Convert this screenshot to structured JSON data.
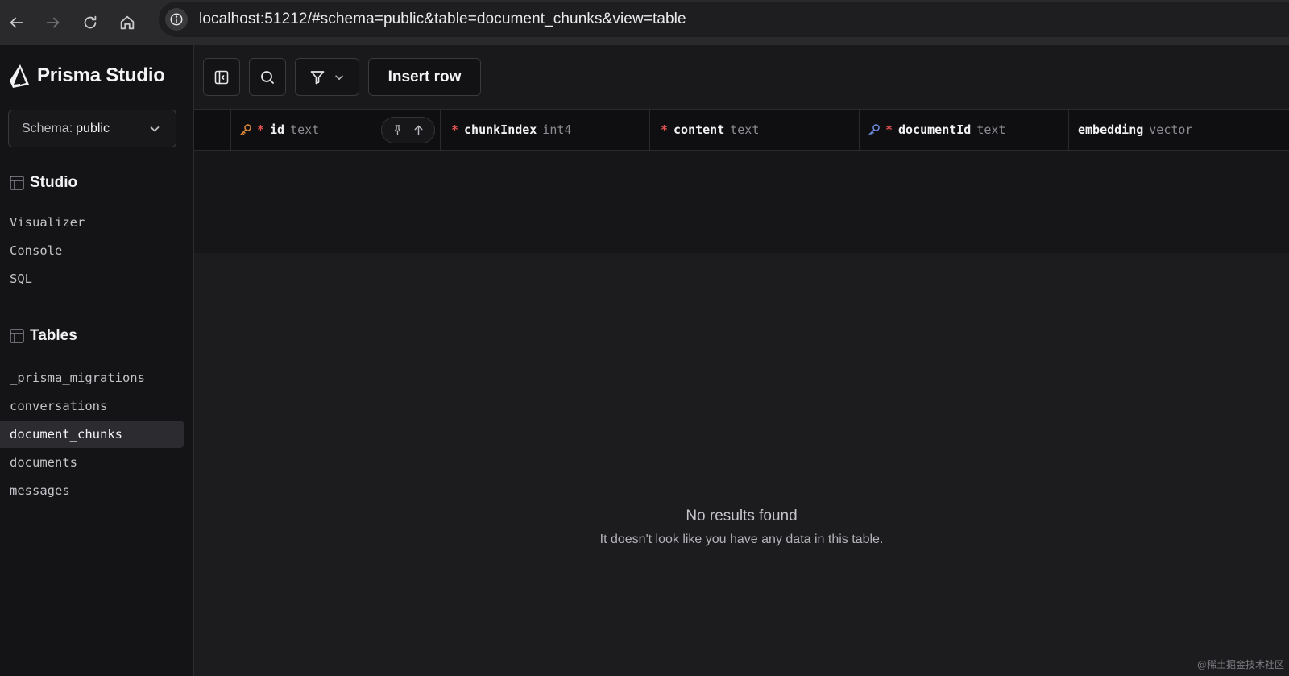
{
  "browser": {
    "url": "localhost:51212/#schema=public&table=document_chunks&view=table"
  },
  "sidebar": {
    "brand": "Prisma Studio",
    "schema_label": "Schema:",
    "schema_value": "public",
    "studio_heading": "Studio",
    "studio_items": [
      "Visualizer",
      "Console",
      "SQL"
    ],
    "tables_heading": "Tables",
    "tables": [
      "_prisma_migrations",
      "conversations",
      "document_chunks",
      "documents",
      "messages"
    ],
    "active_table": "document_chunks"
  },
  "toolbar": {
    "insert_label": "Insert row"
  },
  "columns": [
    {
      "name": "id",
      "type": "text",
      "required": true,
      "key": "primary"
    },
    {
      "name": "chunkIndex",
      "type": "int4",
      "required": true
    },
    {
      "name": "content",
      "type": "text",
      "required": true
    },
    {
      "name": "documentId",
      "type": "text",
      "required": true,
      "key": "foreign"
    },
    {
      "name": "embedding",
      "type": "vector",
      "required": false
    }
  ],
  "empty": {
    "title": "No results found",
    "message": "It doesn't look like you have any data in this table."
  },
  "colors": {
    "primary_key": "#e08a3c",
    "foreign_key": "#6f8ce0",
    "required": "#e0524f"
  },
  "watermark": "@稀土掘金技术社区"
}
